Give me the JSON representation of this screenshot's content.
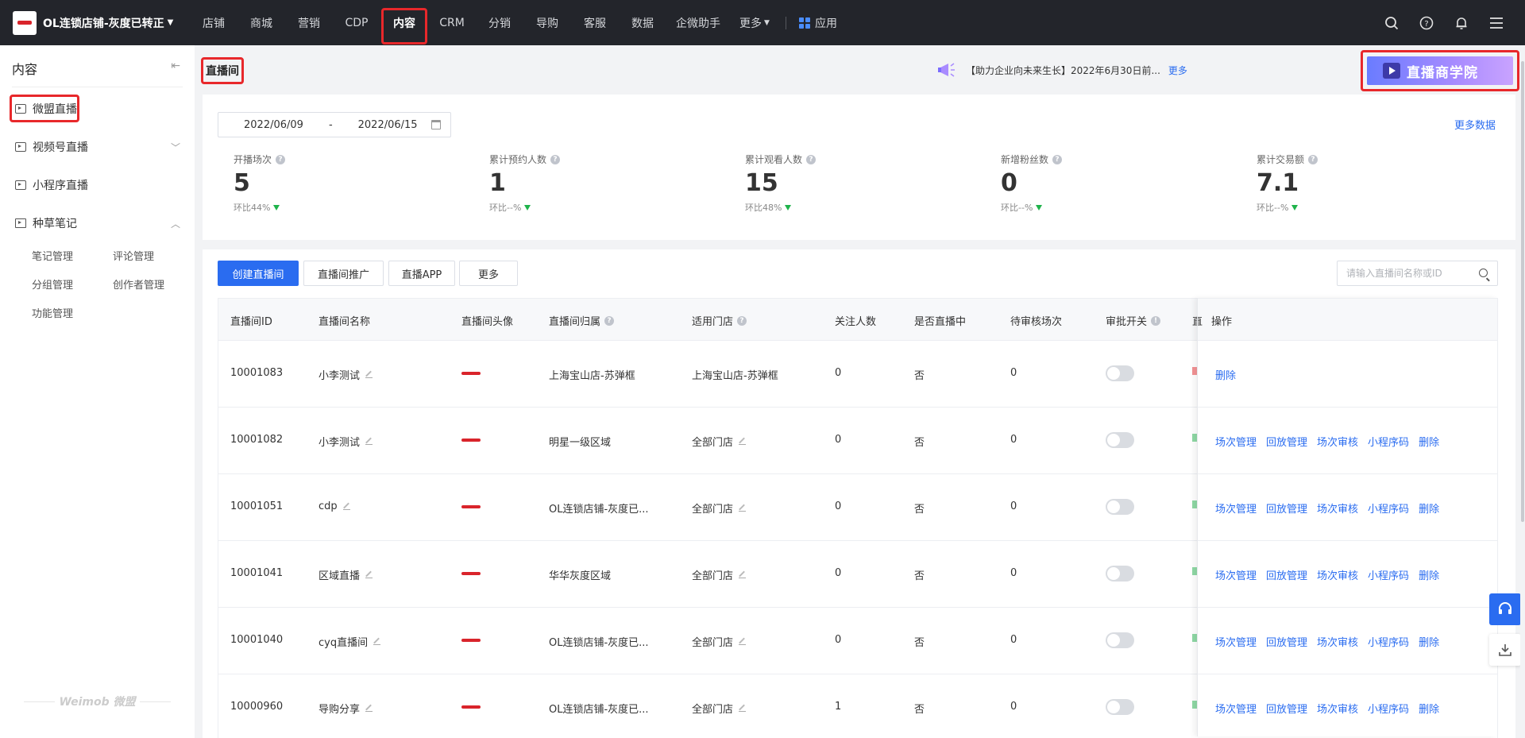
{
  "brand": {
    "name": "OL连锁店铺-灰度已转正"
  },
  "nav": {
    "items": [
      "店铺",
      "商城",
      "营销",
      "CDP",
      "内容",
      "CRM",
      "分销",
      "导购",
      "客服",
      "数据",
      "企微助手"
    ],
    "more": "更多",
    "apps": "应用",
    "active": "内容"
  },
  "sidebar": {
    "title": "内容",
    "items": [
      "微盟直播",
      "视频号直播",
      "小程序直播",
      "种草笔记"
    ],
    "sub_items": [
      "笔记管理",
      "评论管理",
      "分组管理",
      "创作者管理",
      "功能管理"
    ],
    "watermark": "Weimob 微盟"
  },
  "header": {
    "title": "直播间",
    "notice": "【助力企业向未来生长】2022年6月30日前...",
    "notice_more": "更多",
    "banner": "直播商学院"
  },
  "stats": {
    "date_start": "2022/06/09",
    "date_sep": "-",
    "date_end": "2022/06/15",
    "more_data": "更多数据",
    "items": [
      {
        "label": "开播场次",
        "value": "5",
        "ratio": "环比44%"
      },
      {
        "label": "累计预约人数",
        "value": "1",
        "ratio": "环比--%"
      },
      {
        "label": "累计观看人数",
        "value": "15",
        "ratio": "环比48%"
      },
      {
        "label": "新增粉丝数",
        "value": "0",
        "ratio": "环比--%"
      },
      {
        "label": "累计交易额",
        "value": "7.1",
        "ratio": "环比--%"
      }
    ]
  },
  "toolbar": {
    "create": "创建直播间",
    "promote": "直播间推广",
    "app": "直播APP",
    "more": "更多",
    "search_placeholder": "请输入直播间名称或ID"
  },
  "table": {
    "headers": [
      "直播间ID",
      "直播间名称",
      "直播间头像",
      "直播间归属",
      "适用门店",
      "关注人数",
      "是否直播中",
      "待审核场次",
      "审批开关",
      "直",
      "操作"
    ],
    "rows": [
      {
        "id": "10001083",
        "name": "小李测试",
        "owner": "上海宝山店-苏弹框",
        "store": "上海宝山店-苏弹框",
        "followers": "0",
        "live": "否",
        "pending": "0",
        "ops": [
          "删除"
        ]
      },
      {
        "id": "10001082",
        "name": "小李测试",
        "owner": "明星一级区域",
        "store": "全部门店",
        "followers": "0",
        "live": "否",
        "pending": "0",
        "ops": [
          "场次管理",
          "回放管理",
          "场次审核",
          "小程序码",
          "删除"
        ]
      },
      {
        "id": "10001051",
        "name": "cdp",
        "owner": "OL连锁店铺-灰度已...",
        "store": "全部门店",
        "followers": "0",
        "live": "否",
        "pending": "0",
        "ops": [
          "场次管理",
          "回放管理",
          "场次审核",
          "小程序码",
          "删除"
        ]
      },
      {
        "id": "10001041",
        "name": "区域直播",
        "owner": "华华灰度区域",
        "store": "全部门店",
        "followers": "0",
        "live": "否",
        "pending": "0",
        "ops": [
          "场次管理",
          "回放管理",
          "场次审核",
          "小程序码",
          "删除"
        ]
      },
      {
        "id": "10001040",
        "name": "cyq直播间",
        "owner": "OL连锁店铺-灰度已...",
        "store": "全部门店",
        "followers": "0",
        "live": "否",
        "pending": "0",
        "ops": [
          "场次管理",
          "回放管理",
          "场次审核",
          "小程序码",
          "删除"
        ]
      },
      {
        "id": "10000960",
        "name": "导购分享",
        "owner": "OL连锁店铺-灰度已...",
        "store": "全部门店",
        "followers": "1",
        "live": "否",
        "pending": "0",
        "ops": [
          "场次管理",
          "回放管理",
          "场次审核",
          "小程序码",
          "删除"
        ]
      }
    ]
  },
  "colors": {
    "accent": "#2a6cf0",
    "highlight": "#e8282b",
    "topbar": "#23252b",
    "up_down": "#1fb34b"
  }
}
